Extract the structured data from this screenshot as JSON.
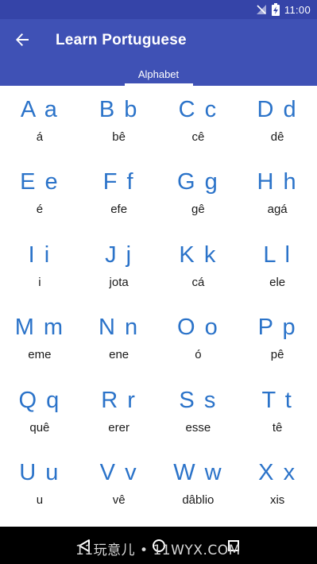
{
  "status_bar": {
    "time": "11:00",
    "icons": [
      "signal-off-icon",
      "battery-charging-icon"
    ]
  },
  "app_bar": {
    "title": "Learn Portuguese",
    "back_icon": "arrow-left-icon",
    "tabs": [
      {
        "label": "Alphabet",
        "selected": true
      }
    ]
  },
  "alphabet": [
    {
      "letter": "A a",
      "name": "á"
    },
    {
      "letter": "B b",
      "name": "bê"
    },
    {
      "letter": "C c",
      "name": "cê"
    },
    {
      "letter": "D d",
      "name": "dê"
    },
    {
      "letter": "E e",
      "name": "é"
    },
    {
      "letter": "F f",
      "name": "efe"
    },
    {
      "letter": "G g",
      "name": "gê"
    },
    {
      "letter": "H h",
      "name": "agá"
    },
    {
      "letter": "I i",
      "name": "i"
    },
    {
      "letter": "J j",
      "name": "jota"
    },
    {
      "letter": "K k",
      "name": "cá"
    },
    {
      "letter": "L l",
      "name": "ele"
    },
    {
      "letter": "M m",
      "name": "eme"
    },
    {
      "letter": "N n",
      "name": "ene"
    },
    {
      "letter": "O o",
      "name": "ó"
    },
    {
      "letter": "P p",
      "name": "pê"
    },
    {
      "letter": "Q q",
      "name": "quê"
    },
    {
      "letter": "R r",
      "name": "erer"
    },
    {
      "letter": "S s",
      "name": "esse"
    },
    {
      "letter": "T t",
      "name": "tê"
    },
    {
      "letter": "U u",
      "name": "u"
    },
    {
      "letter": "V v",
      "name": "vê"
    },
    {
      "letter": "W w",
      "name": "dâblio"
    },
    {
      "letter": "X x",
      "name": "xis"
    }
  ],
  "nav_bar": {
    "buttons": [
      "back-triangle-icon",
      "home-circle-icon",
      "recents-square-icon"
    ],
    "watermark": "11玩意儿 • 11WYX.COM"
  },
  "colors": {
    "status_bar": "#3544a8",
    "app_bar": "#3f51b5",
    "letter": "#2b73c9",
    "name": "#1a1a1a",
    "nav_bar": "#000000"
  }
}
